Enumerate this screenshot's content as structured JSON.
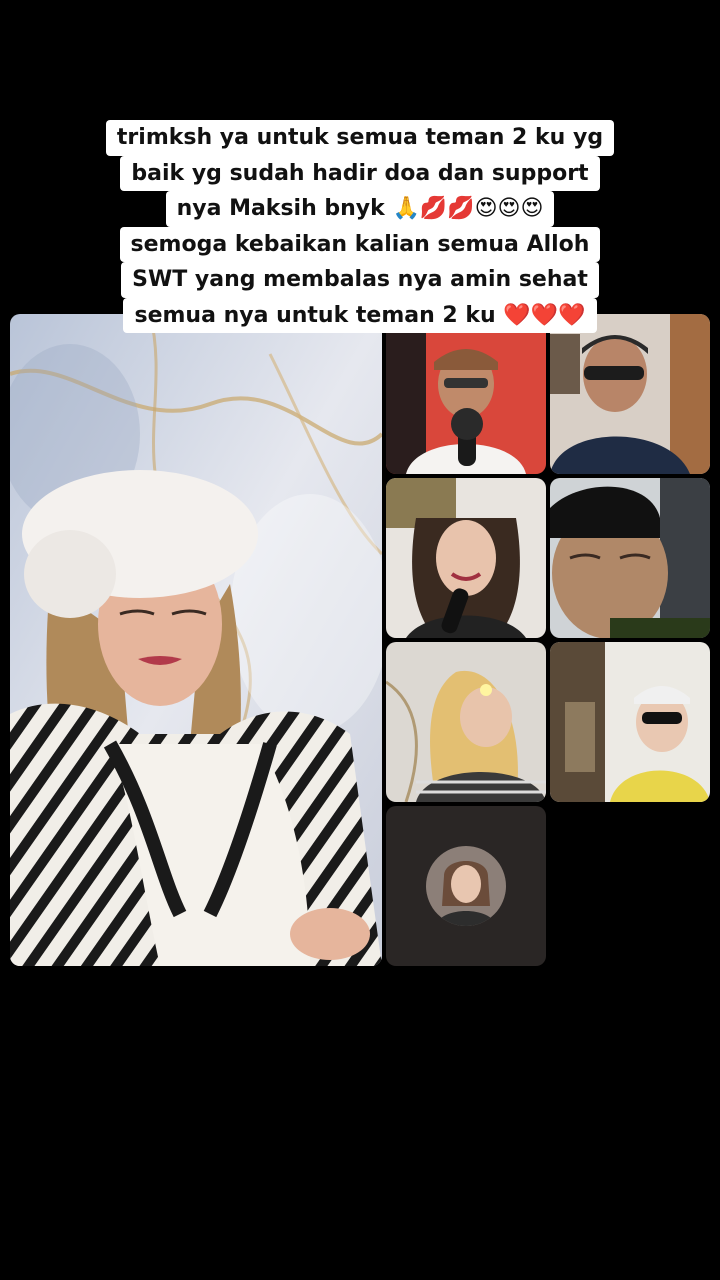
{
  "caption": {
    "lines": [
      "trimksh ya untuk semua teman 2 ku yg",
      "baik yg sudah hadir doa dan support",
      "nya Maksih bnyk 🙏💋💋😍😍😍",
      "semoga kebaikan kalian semua Alloh",
      "SWT yang membalas nya amin sehat",
      "semua nya untuk teman 2 ku ❤️❤️❤️"
    ]
  },
  "colors": {
    "background": "#000000",
    "caption_bg": "#ffffff",
    "caption_text": "#111111",
    "empty_tile": "#2a2625"
  },
  "tiles": [
    {
      "role": "host",
      "description_icon": "video-feed-icon"
    },
    {
      "role": "guest",
      "description_icon": "video-feed-icon"
    },
    {
      "role": "guest",
      "description_icon": "video-feed-icon"
    },
    {
      "role": "guest",
      "description_icon": "video-feed-icon"
    },
    {
      "role": "guest",
      "description_icon": "video-feed-icon"
    },
    {
      "role": "guest",
      "description_icon": "video-feed-icon"
    },
    {
      "role": "guest",
      "description_icon": "video-feed-icon"
    },
    {
      "role": "guest-audio",
      "description_icon": "avatar-icon"
    }
  ]
}
